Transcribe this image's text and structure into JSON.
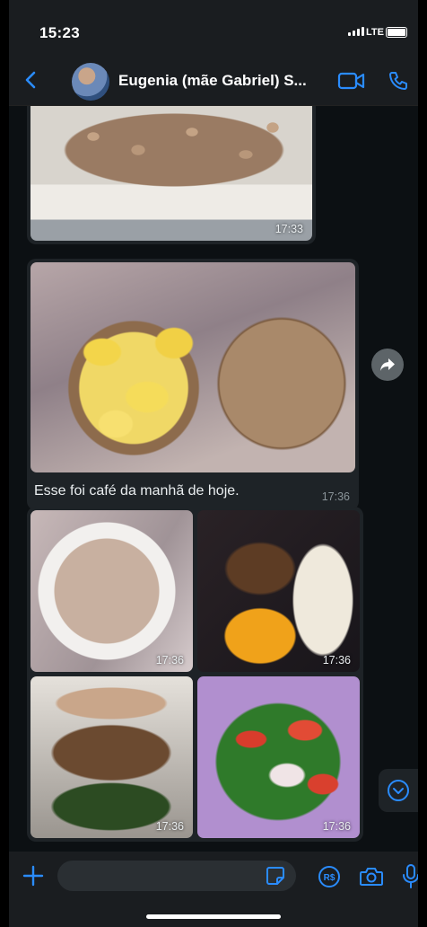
{
  "status": {
    "time": "15:23",
    "network": "LTE"
  },
  "header": {
    "contact_name": "Eugenia (mãe Gabriel) S..."
  },
  "messages": [
    {
      "type": "image",
      "time": "17:33"
    },
    {
      "type": "image",
      "caption": "Esse foi café da manhã de hoje.",
      "time": "17:36"
    },
    {
      "type": "album",
      "items": [
        {
          "time": "17:36"
        },
        {
          "time": "17:36"
        },
        {
          "time": "17:36"
        },
        {
          "time": "17:36"
        }
      ]
    }
  ],
  "input": {
    "placeholder": ""
  },
  "colors": {
    "accent": "#2a8cff",
    "bubble": "#1e2327",
    "background": "#0c1013"
  },
  "icons": [
    "back-icon",
    "video-call-icon",
    "voice-call-icon",
    "forward-icon",
    "scroll-down-icon",
    "plus-icon",
    "sticker-icon",
    "pix-icon",
    "camera-icon",
    "microphone-icon"
  ]
}
